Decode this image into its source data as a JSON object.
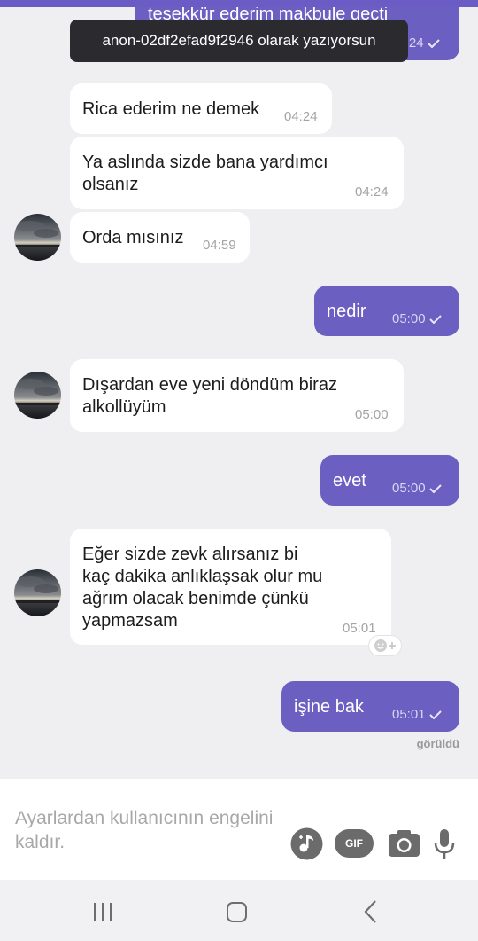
{
  "colors": {
    "accent": "#6b60c2",
    "incoming": "#ffffff",
    "background": "#efeff1"
  },
  "toast": {
    "text": "anon-02df2efad9f2946 olarak yazıyorsun"
  },
  "messages": [
    {
      "dir": "out",
      "text": "teşekkür ederim makbule geçti",
      "time": "04:24",
      "status": "sent"
    },
    {
      "dir": "in",
      "text": "Rica ederim ne demek",
      "time": "04:24"
    },
    {
      "dir": "in",
      "lines": [
        "Ya aslında sizde bana yardımcı",
        "olsanız"
      ],
      "time": "04:24"
    },
    {
      "dir": "in",
      "text": "Orda mısınız",
      "time": "04:59"
    },
    {
      "dir": "out",
      "text": "nedir",
      "time": "05:00",
      "status": "sent"
    },
    {
      "dir": "in",
      "lines": [
        "Dışardan eve yeni döndüm biraz",
        "alkollüyüm"
      ],
      "time": "05:00"
    },
    {
      "dir": "out",
      "text": "evet",
      "time": "05:00",
      "status": "sent"
    },
    {
      "dir": "in",
      "lines": [
        "Eğer sizde zevk alırsanız bi",
        "kaç dakika anlıklaşsak olur mu",
        "ağrım olacak benimde çünkü",
        "yapmazsam"
      ],
      "time": "05:01"
    },
    {
      "dir": "out",
      "text": "işine bak",
      "time": "05:01",
      "status": "sent"
    }
  ],
  "seen_label": "görüldü",
  "reaction_icon": "emoji-add-icon",
  "input": {
    "placeholder": "Ayarlardan kullanıcının engelini kaldır."
  },
  "input_icons": [
    "music-icon",
    "gif-icon",
    "camera-icon",
    "microphone-icon"
  ],
  "gif_label": "GIF",
  "nav_icons": [
    "recent-apps-icon",
    "home-icon",
    "back-icon"
  ]
}
